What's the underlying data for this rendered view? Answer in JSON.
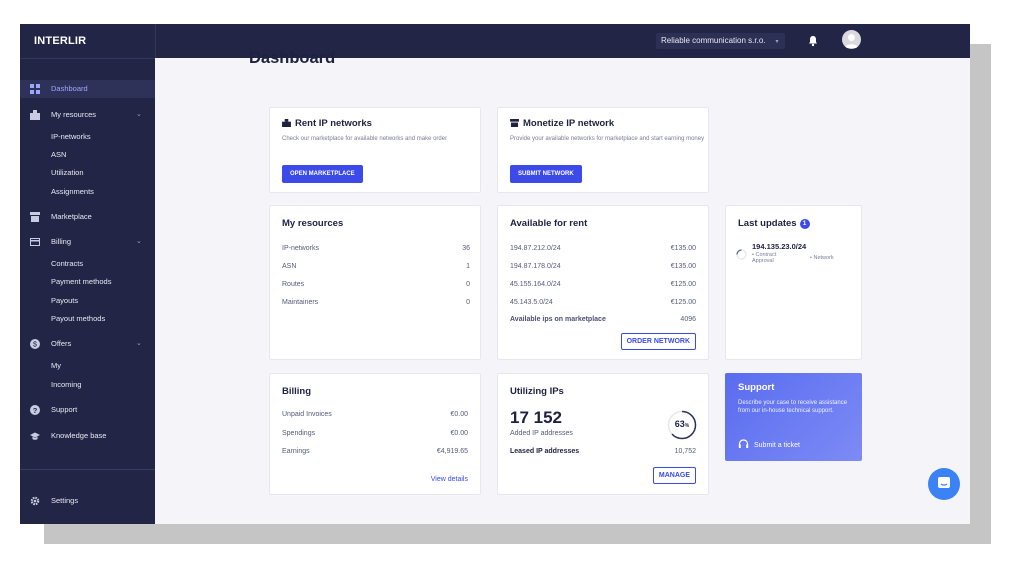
{
  "app": {
    "logo": "INTERLIR",
    "company": "Reliable communication s.r.o.",
    "company_caret": "▾"
  },
  "sidebar": {
    "items": [
      {
        "label": "Dashboard",
        "icon": "grid-icon"
      },
      {
        "label": "My resources",
        "icon": "box-icon",
        "chevron": "⌄"
      },
      {
        "label": "Marketplace",
        "icon": "store-icon"
      },
      {
        "label": "Billing",
        "icon": "card-icon",
        "chevron": "⌄"
      },
      {
        "label": "Offers",
        "icon": "coin-icon",
        "chevron": "⌄"
      },
      {
        "label": "Support",
        "icon": "help-icon"
      },
      {
        "label": "Knowledge base",
        "icon": "graduation-icon"
      },
      {
        "label": "Settings",
        "icon": "gear-icon"
      }
    ],
    "resources_sub": [
      "IP-networks",
      "ASN",
      "Utilization",
      "Assignments"
    ],
    "billing_sub": [
      "Contracts",
      "Payment methods",
      "Payouts",
      "Payout methods"
    ],
    "offers_sub": [
      "My",
      "Incoming"
    ]
  },
  "page": {
    "title": "Dashboard"
  },
  "rent_card": {
    "title": "Rent IP networks",
    "desc": "Check our marketplace for available networks and make order",
    "button": "OPEN MARKETPLACE"
  },
  "monetize_card": {
    "title": "Monetize IP network",
    "desc": "Provide your available networks for marketplace and start earning money",
    "button": "SUBMIT NETWORK"
  },
  "my_resources": {
    "title": "My resources",
    "rows": [
      {
        "label": "IP-networks",
        "value": "36"
      },
      {
        "label": "ASN",
        "value": "1"
      },
      {
        "label": "Routes",
        "value": "0"
      },
      {
        "label": "Maintainers",
        "value": "0"
      }
    ]
  },
  "available": {
    "title": "Available for rent",
    "rows": [
      {
        "label": "194.87.212.0/24",
        "value": "€135.00"
      },
      {
        "label": "194.87.178.0/24",
        "value": "€135.00"
      },
      {
        "label": "45.155.164.0/24",
        "value": "€125.00"
      },
      {
        "label": "45.143.5.0/24",
        "value": "€125.00"
      }
    ],
    "total_label": "Available ips on marketplace",
    "total_value": "4096",
    "button": "ORDER NETWORK"
  },
  "updates": {
    "title": "Last updates",
    "badge": "1",
    "item": {
      "network": "194.135.23.0/24",
      "status": "Contract Approval",
      "type": "Network"
    }
  },
  "billing": {
    "title": "Billing",
    "rows": [
      {
        "label": "Unpaid Invoices",
        "value": "€0.00"
      },
      {
        "label": "Spendings",
        "value": "€0.00"
      },
      {
        "label": "Earnings",
        "value": "€4,919.65"
      }
    ],
    "link": "View details"
  },
  "utilizing": {
    "title": "Utilizing IPs",
    "big_number": "17 152",
    "big_label": "Added IP addresses",
    "percent": 63,
    "percent_label": "63",
    "percent_sign": "%",
    "leased_label": "Leased IP addresses",
    "leased_value": "10,752",
    "button": "MANAGE"
  },
  "support": {
    "title": "Support",
    "desc": "Describe your case to receive assistance from our in-house technical support.",
    "link": "Submit a ticket"
  },
  "colors": {
    "sidebar": "#232547",
    "primary": "#3b4ae8",
    "background": "#f5f5f9"
  }
}
